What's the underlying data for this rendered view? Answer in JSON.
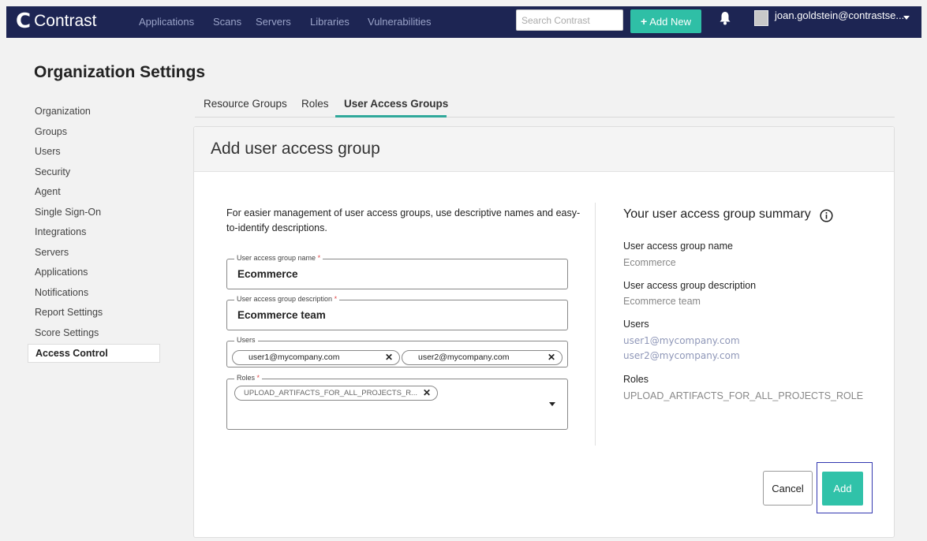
{
  "nav": {
    "logo_text": "Contrast",
    "links": [
      "Applications",
      "Scans",
      "Servers",
      "Libraries",
      "Vulnerabilities"
    ],
    "search_placeholder": "Search Contrast",
    "add_new_label": "Add New",
    "user_label": "joan.goldstein@contrastse..."
  },
  "page": {
    "title": "Organization Settings"
  },
  "sidebar": {
    "items": [
      {
        "label": "Organization"
      },
      {
        "label": "Groups"
      },
      {
        "label": "Users"
      },
      {
        "label": "Security"
      },
      {
        "label": "Agent"
      },
      {
        "label": "Single Sign-On"
      },
      {
        "label": "Integrations"
      },
      {
        "label": "Servers"
      },
      {
        "label": "Applications"
      },
      {
        "label": "Notifications"
      },
      {
        "label": "Report Settings"
      },
      {
        "label": "Score Settings"
      },
      {
        "label": "Access Control",
        "active": true
      }
    ]
  },
  "tabs": {
    "items": [
      {
        "label": "Resource Groups"
      },
      {
        "label": "Roles"
      },
      {
        "label": "User Access Groups",
        "active": true
      }
    ]
  },
  "form": {
    "title": "Add user access group",
    "intro": "For easier management of user access groups, use descriptive names and easy-to-identify descriptions.",
    "name_field": {
      "label": "User access group name",
      "required_mark": "*",
      "value": "Ecommerce"
    },
    "description_field": {
      "label": "User access group description",
      "required_mark": "*",
      "value": "Ecommerce team"
    },
    "users_field": {
      "label": "Users",
      "chips": [
        "user1@mycompany.com",
        "user2@mycompany.com"
      ]
    },
    "roles_field": {
      "label": "Roles",
      "required_mark": "*",
      "chips": [
        "UPLOAD_ARTIFACTS_FOR_ALL_PROJECTS_R..."
      ]
    },
    "cancel_label": "Cancel",
    "add_label": "Add"
  },
  "summary": {
    "title": "Your user access group summary",
    "name_label": "User access group name",
    "name_value": "Ecommerce",
    "description_label": "User access group description",
    "description_value": "Ecommerce team",
    "users_label": "Users",
    "users": [
      "user1@mycompany.com",
      "user2@mycompany.com"
    ],
    "roles_label": "Roles",
    "roles_value": "UPLOAD_ARTIFACTS_FOR_ALL_PROJECTS_ROLE"
  },
  "colors": {
    "nav_bg": "#1d2553",
    "accent": "#30c2a9",
    "focus_outline": "#3237b0"
  },
  "icons": {
    "logo": "contrast-logo-icon",
    "add": "plus-icon",
    "notifications": "bell-icon",
    "user": "avatar-icon",
    "menu": "caret-down-icon",
    "remove_chip": "close-icon",
    "dropdown": "chevron-down-icon",
    "info": "info-icon"
  }
}
